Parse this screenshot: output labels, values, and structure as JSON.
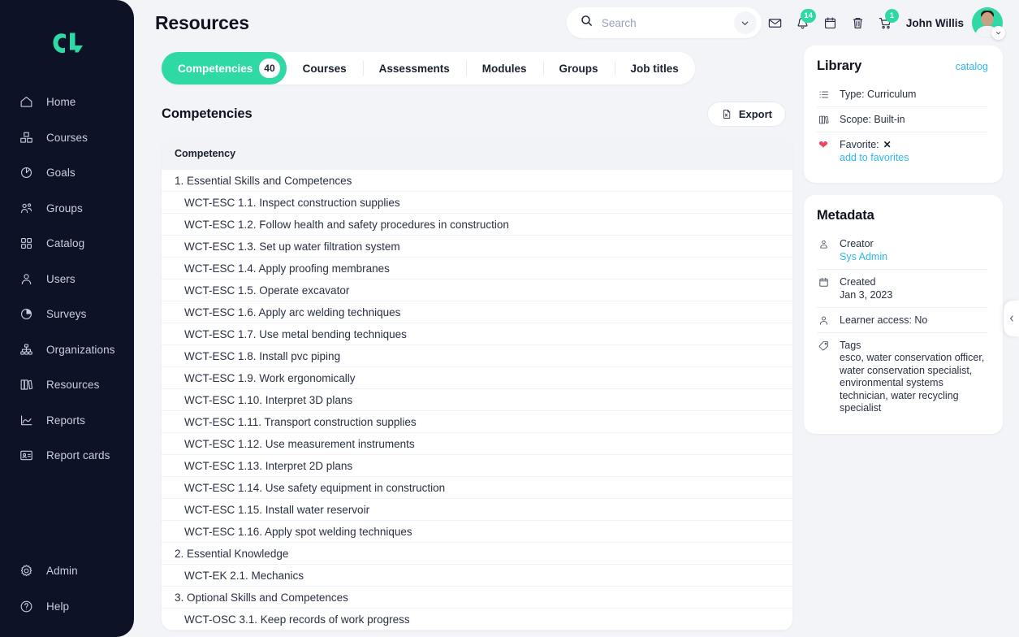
{
  "brand": {
    "logo_alt": "CL",
    "accent": "#2fd9a5",
    "sidebar_bg": "#0d1226",
    "link_blue": "#2fb7ef",
    "favorite_red": "#f0465b"
  },
  "header": {
    "page_title": "Resources",
    "search": {
      "placeholder": "Search",
      "value": ""
    },
    "user_name": "John Willis",
    "notifications_badge": "14",
    "cart_badge": "1"
  },
  "sidebar": {
    "items": [
      {
        "label": "Home",
        "icon": "home-icon"
      },
      {
        "label": "Courses",
        "icon": "courses-icon"
      },
      {
        "label": "Goals",
        "icon": "goals-icon"
      },
      {
        "label": "Groups",
        "icon": "groups-icon"
      },
      {
        "label": "Catalog",
        "icon": "catalog-icon"
      },
      {
        "label": "Users",
        "icon": "users-icon"
      },
      {
        "label": "Surveys",
        "icon": "surveys-icon"
      },
      {
        "label": "Organizations",
        "icon": "organizations-icon"
      },
      {
        "label": "Resources",
        "icon": "resources-icon"
      },
      {
        "label": "Reports",
        "icon": "reports-icon"
      },
      {
        "label": "Report cards",
        "icon": "report-cards-icon"
      }
    ],
    "bottom_items": [
      {
        "label": "Admin",
        "icon": "gear-icon"
      },
      {
        "label": "Help",
        "icon": "help-icon"
      }
    ]
  },
  "tabs": [
    {
      "label": "Competencies",
      "count": "40",
      "active": true
    },
    {
      "label": "Courses",
      "count": "",
      "active": false
    },
    {
      "label": "Assessments",
      "count": "",
      "active": false
    },
    {
      "label": "Modules",
      "count": "",
      "active": false
    },
    {
      "label": "Groups",
      "count": "",
      "active": false
    },
    {
      "label": "Job titles",
      "count": "",
      "active": false
    }
  ],
  "section": {
    "title": "Competencies",
    "export_label": "Export"
  },
  "table": {
    "column_header": "Competency",
    "rows": [
      {
        "text": "1. Essential Skills and Competences",
        "level": "group"
      },
      {
        "text": "WCT-ESC 1.1. Inspect construction supplies",
        "level": "child"
      },
      {
        "text": "WCT-ESC 1.2. Follow health and safety procedures in construction",
        "level": "child"
      },
      {
        "text": "WCT-ESC 1.3. Set up water filtration system",
        "level": "child"
      },
      {
        "text": "WCT-ESC 1.4. Apply proofing membranes",
        "level": "child"
      },
      {
        "text": "WCT-ESC 1.5. Operate excavator",
        "level": "child"
      },
      {
        "text": "WCT-ESC 1.6. Apply arc welding techniques",
        "level": "child"
      },
      {
        "text": "WCT-ESC 1.7. Use metal bending techniques",
        "level": "child"
      },
      {
        "text": "WCT-ESC 1.8. Install pvc piping",
        "level": "child"
      },
      {
        "text": "WCT-ESC 1.9. Work ergonomically",
        "level": "child"
      },
      {
        "text": "WCT-ESC 1.10. Interpret 3D plans",
        "level": "child"
      },
      {
        "text": "WCT-ESC 1.11. Transport construction supplies",
        "level": "child"
      },
      {
        "text": "WCT-ESC 1.12. Use measurement instruments",
        "level": "child"
      },
      {
        "text": "WCT-ESC 1.13. Interpret 2D plans",
        "level": "child"
      },
      {
        "text": "WCT-ESC 1.14. Use safety equipment in construction",
        "level": "child"
      },
      {
        "text": "WCT-ESC 1.15. Install water reservoir",
        "level": "child"
      },
      {
        "text": "WCT-ESC 1.16. Apply spot welding techniques",
        "level": "child"
      },
      {
        "text": "2. Essential Knowledge",
        "level": "group"
      },
      {
        "text": "WCT-EK 2.1. Mechanics",
        "level": "child"
      },
      {
        "text": "3. Optional Skills and Competences",
        "level": "group"
      },
      {
        "text": "WCT-OSC 3.1. Keep records of work progress",
        "level": "child"
      }
    ]
  },
  "library": {
    "title": "Library",
    "link": "catalog",
    "type": "Type: Curriculum",
    "scope": "Scope: Built-in",
    "favorite_label": "Favorite:",
    "favorite_value": "✕",
    "favorite_action": "add to favorites"
  },
  "metadata": {
    "title": "Metadata",
    "creator_label": "Creator",
    "creator_value": "Sys Admin",
    "created_label": "Created",
    "created_value": "Jan 3, 2023",
    "learner_access": "Learner access: No",
    "tags_label": "Tags",
    "tags_value": "esco, water conservation officer, water conservation specialist, environmental systems technician, water recycling specialist"
  }
}
